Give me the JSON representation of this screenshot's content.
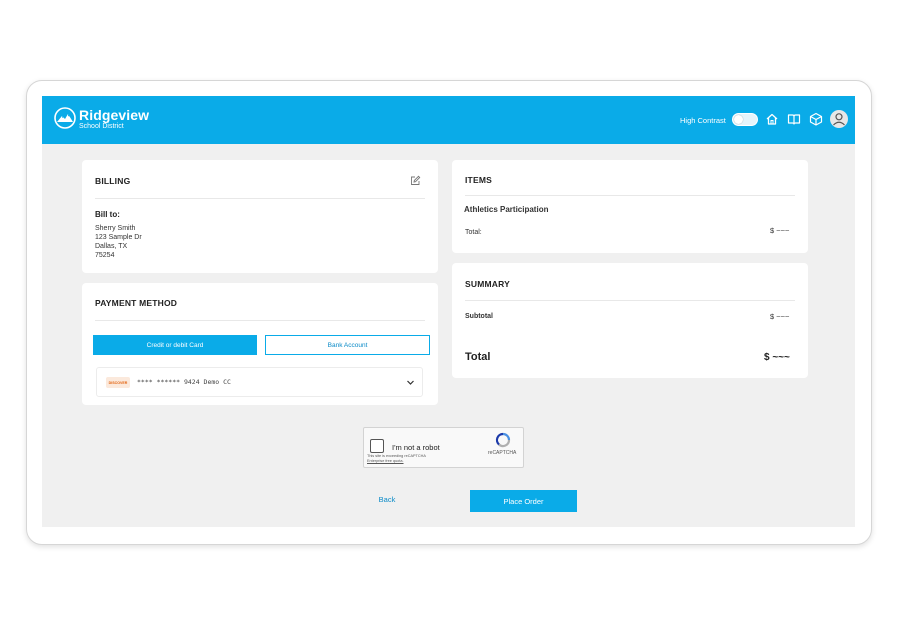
{
  "header": {
    "brand_name": "Ridgeview",
    "brand_sub": "School District",
    "high_contrast_label": "High Contrast",
    "icons": [
      "home-icon",
      "book-icon",
      "box-icon",
      "user-icon"
    ]
  },
  "billing": {
    "title": "BILLING",
    "bill_to_label": "Bill to:",
    "name": "Sherry Smith",
    "street": "123 Sample Dr",
    "city": "Dallas, TX",
    "zip": "75254"
  },
  "payment": {
    "title": "PAYMENT METHOD",
    "credit_button": "Credit or debit Card",
    "bank_button": "Bank Account",
    "card_brand": "DISCOVER",
    "card_text": "**** ****** 9424 Demo CC"
  },
  "items": {
    "title": "ITEMS",
    "item_name": "Athletics Participation",
    "total_label": "Total:",
    "total_value": "$ ~~~"
  },
  "summary": {
    "title": "SUMMARY",
    "subtotal_label": "Subtotal",
    "subtotal_value": "$ ~~~",
    "total_label": "Total",
    "total_value": "$ ~~~"
  },
  "captcha": {
    "label": "I'm not a robot",
    "brand": "reCAPTCHA",
    "note_line1": "This site is exceeding reCAPTCHA",
    "note_line2": "Enterprise free quota."
  },
  "actions": {
    "back": "Back",
    "place_order": "Place Order"
  },
  "colors": {
    "accent": "#0aabe8",
    "background": "#f0f0f0"
  }
}
